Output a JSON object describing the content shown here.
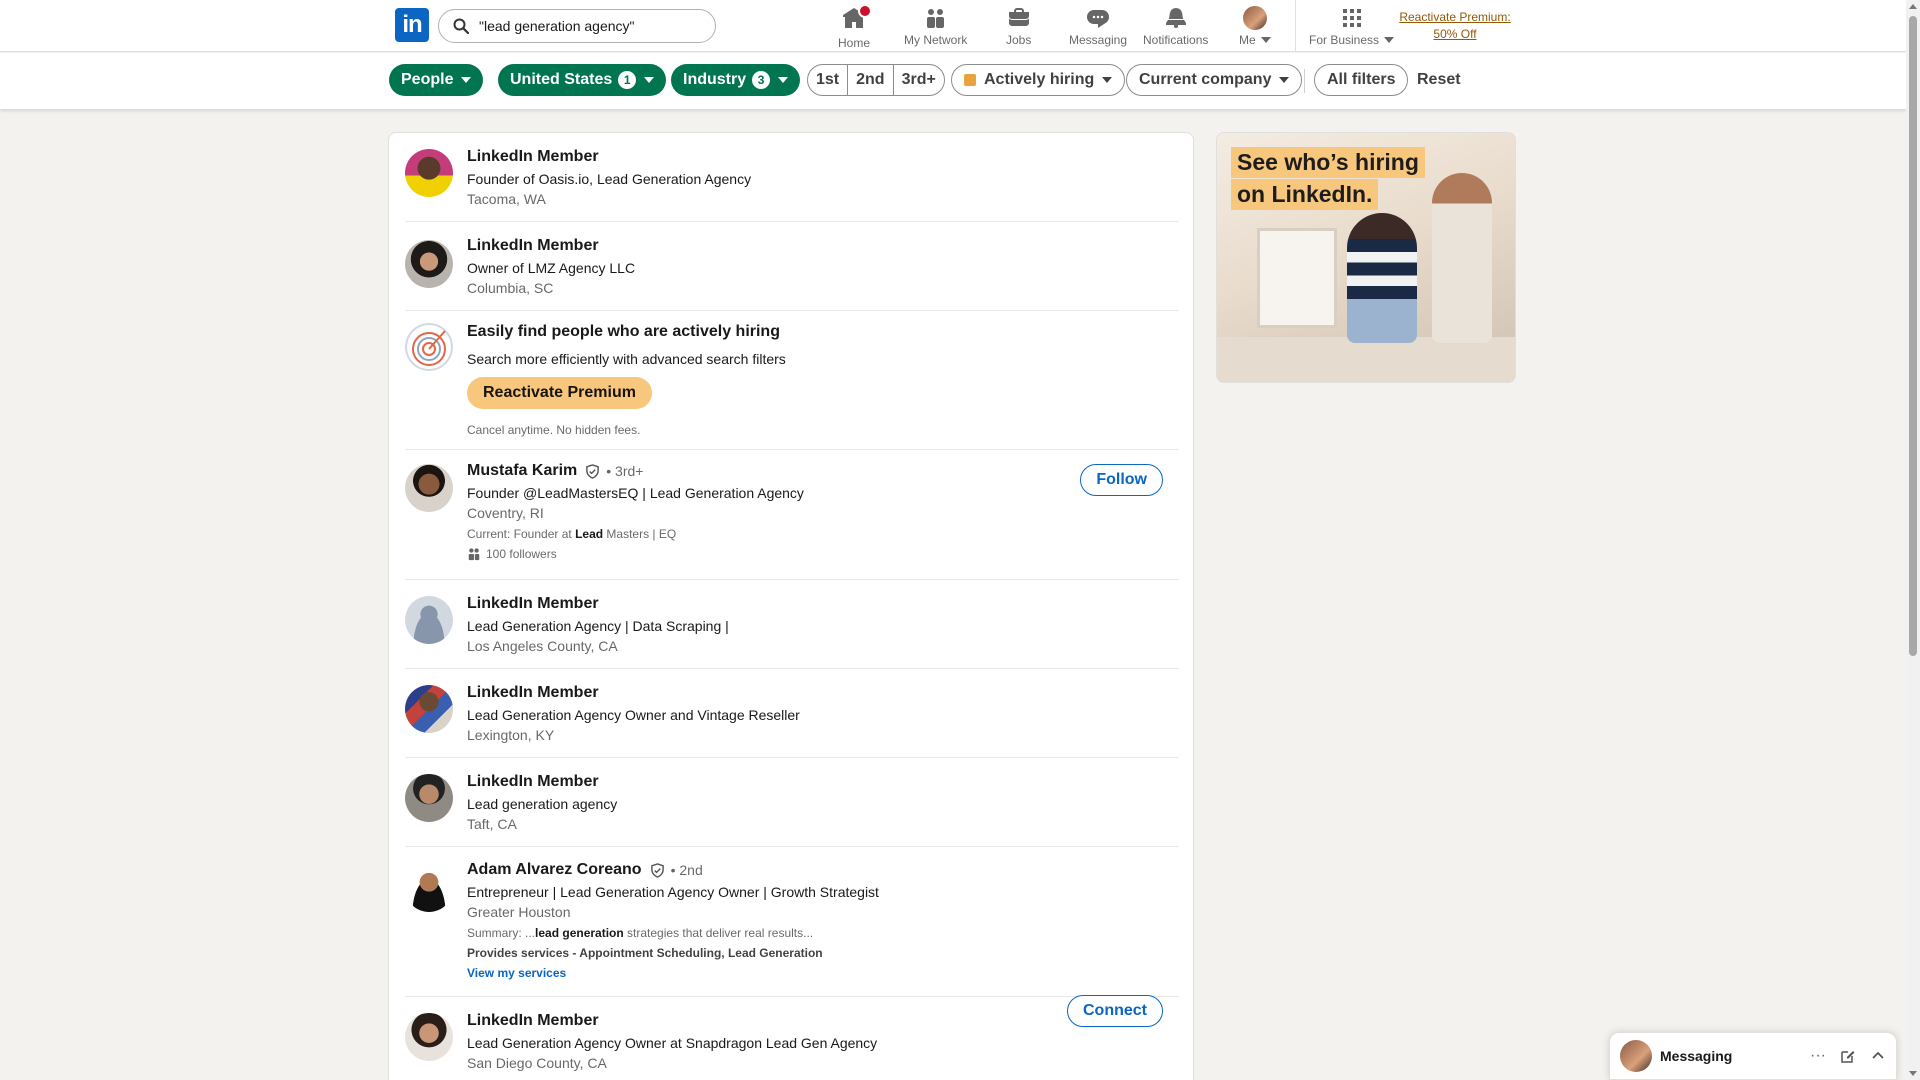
{
  "nav": {
    "search_value": "\"lead generation agency\"",
    "home": "Home",
    "network": "My Network",
    "jobs": "Jobs",
    "messaging": "Messaging",
    "notifications": "Notifications",
    "me": "Me",
    "for_business": "For Business",
    "premium_line1": "Reactivate Premium:",
    "premium_line2": "50% Off",
    "logo_text": "in"
  },
  "filters": {
    "people": "People",
    "location": "United States",
    "location_count": "1",
    "industry": "Industry",
    "industry_count": "3",
    "degree_1": "1st",
    "degree_2": "2nd",
    "degree_3": "3rd+",
    "actively_hiring": "Actively hiring",
    "current_company": "Current company",
    "all_filters": "All filters",
    "reset": "Reset"
  },
  "results": [
    {
      "name": "LinkedIn Member",
      "headline": "Founder of Oasis.io, Lead Generation Agency",
      "location": "Tacoma, WA"
    },
    {
      "name": "LinkedIn Member",
      "headline": "Owner of LMZ Agency LLC",
      "location": "Columbia, SC"
    },
    {
      "name": "Mustafa Karim",
      "degree": "• 3rd+",
      "headline": "Founder @LeadMastersEQ | Lead Generation Agency",
      "location": "Coventry, RI",
      "current_prefix": "Current: Founder at ",
      "current_bold": "Lead",
      "current_suffix": " Masters | EQ",
      "followers": "100 followers",
      "action": "Follow"
    },
    {
      "name": "LinkedIn Member",
      "headline": "Lead Generation Agency | Data Scraping |",
      "location": "Los Angeles County, CA"
    },
    {
      "name": "LinkedIn Member",
      "headline": "Lead Generation Agency Owner and Vintage Reseller",
      "location": "Lexington, KY"
    },
    {
      "name": "LinkedIn Member",
      "headline": "Lead generation agency",
      "location": "Taft, CA"
    },
    {
      "name": "Adam Alvarez Coreano",
      "degree": "• 2nd",
      "headline": "Entrepreneur | Lead Generation Agency Owner | Growth Strategist",
      "location": "Greater Houston",
      "summary_prefix": "Summary: ...",
      "summary_bold": "lead generation",
      "summary_suffix": " strategies that deliver real results...",
      "services": "Provides services - Appointment Scheduling, Lead Generation",
      "services_link": "View my services",
      "action": "Connect"
    },
    {
      "name": "LinkedIn Member",
      "headline": "Lead Generation Agency Owner at Snapdragon Lead Gen Agency",
      "location": "San Diego County, CA"
    }
  ],
  "promo": {
    "title": "Easily find people who are actively hiring",
    "subtitle": "Search more efficiently with advanced search filters",
    "button": "Reactivate Premium",
    "note": "Cancel anytime. No hidden fees."
  },
  "ad": {
    "line1": "See who’s hiring",
    "line2": "on LinkedIn."
  },
  "messaging_bar": {
    "title": "Messaging",
    "more": "···"
  },
  "colors": {
    "brand": "#0a66c2",
    "filter_green": "#01754f",
    "premium": "#f8c77e",
    "notification_badge": "#cb112d"
  }
}
